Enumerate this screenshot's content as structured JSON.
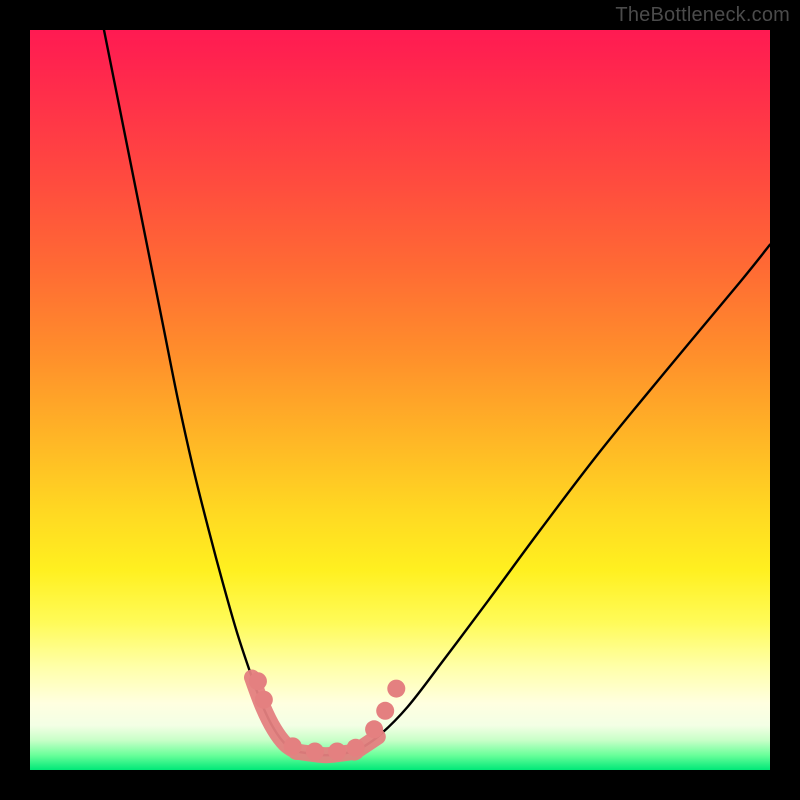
{
  "attribution": "TheBottleneck.com",
  "colors": {
    "frame": "#000000",
    "curve": "#000000",
    "markers": "#e48080",
    "gradient_top": "#ff1a52",
    "gradient_bottom": "#00e878"
  },
  "chart_data": {
    "type": "line",
    "title": "",
    "xlabel": "",
    "ylabel": "",
    "xlim": [
      0,
      100
    ],
    "ylim": [
      0,
      100
    ],
    "grid": false,
    "legend": false,
    "note": "Axes are unlabeled in the source image; values are estimated from pixel positions on a 0–100 normalized scale (y=0 at bottom, y=100 at top).",
    "series": [
      {
        "name": "left-curve",
        "x": [
          10,
          12,
          14,
          16,
          18,
          20,
          22,
          24,
          26,
          28,
          30,
          31.5,
          33,
          34.5,
          36
        ],
        "y": [
          100,
          90,
          80,
          70,
          60,
          50,
          41,
          33,
          25.5,
          18.5,
          12.5,
          8.5,
          5.5,
          3.5,
          2.5
        ]
      },
      {
        "name": "floor",
        "x": [
          36,
          38,
          40,
          42,
          44
        ],
        "y": [
          2.5,
          2.2,
          2.0,
          2.2,
          2.5
        ]
      },
      {
        "name": "right-curve",
        "x": [
          44,
          47,
          51,
          56,
          62,
          69,
          77,
          86,
          96,
          100
        ],
        "y": [
          2.5,
          4.5,
          8.5,
          15,
          23,
          32.5,
          43,
          54,
          66,
          71
        ]
      }
    ],
    "markers": [
      {
        "series": "left-curve",
        "x": 30.8,
        "y": 12.0
      },
      {
        "series": "left-curve",
        "x": 31.6,
        "y": 9.5
      },
      {
        "series": "floor",
        "x": 35.5,
        "y": 3.2
      },
      {
        "series": "floor",
        "x": 38.5,
        "y": 2.5
      },
      {
        "series": "floor",
        "x": 41.5,
        "y": 2.5
      },
      {
        "series": "floor",
        "x": 44.0,
        "y": 3.0
      },
      {
        "series": "right-curve",
        "x": 46.5,
        "y": 5.5
      },
      {
        "series": "right-curve",
        "x": 48.0,
        "y": 8.0
      },
      {
        "series": "right-curve",
        "x": 49.5,
        "y": 11.0
      }
    ]
  }
}
